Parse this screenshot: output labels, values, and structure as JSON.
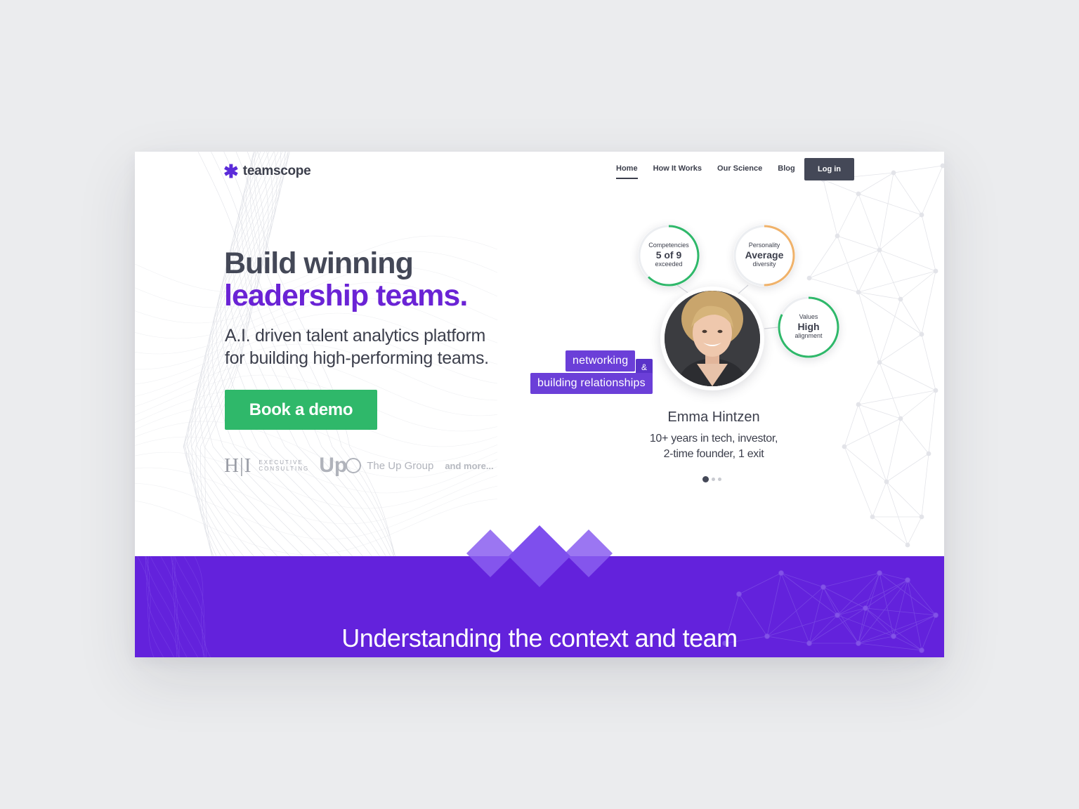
{
  "header": {
    "logo_mark": "✱",
    "logo_text": "teamscope",
    "nav": [
      {
        "label": "Home",
        "active": true
      },
      {
        "label": "How It Works",
        "active": false
      },
      {
        "label": "Our Science",
        "active": false
      },
      {
        "label": "Blog",
        "active": false
      }
    ],
    "login_label": "Log in"
  },
  "hero": {
    "headline_line1": "Build winning",
    "headline_line2": "leadership teams.",
    "subhead_line1": "A.I. driven talent analytics platform",
    "subhead_line2": "for building high-performing teams.",
    "cta_label": "Book a demo"
  },
  "clients": {
    "hi_logo": "H|I",
    "hi_sub_line1": "EXECUTIVE",
    "hi_sub_line2": "CONSULTING",
    "up_logo": "Up",
    "up_name": "The Up Group",
    "more": "and more..."
  },
  "profile": {
    "metrics": [
      {
        "label": "Competencies",
        "value": "5 of 9",
        "note": "exceeded",
        "progress": 0.62,
        "color": "#2fb86a"
      },
      {
        "label": "Personality",
        "value": "Average",
        "note": "diversity",
        "progress": 0.5,
        "color": "#f0b26a"
      },
      {
        "label": "Values",
        "value": "High",
        "note": "alignment",
        "progress": 0.82,
        "color": "#2fb86a"
      }
    ],
    "tags": [
      "networking",
      "building relationships"
    ],
    "amp": "&",
    "name": "Emma Hintzen",
    "desc_line1": "10+ years in tech, investor,",
    "desc_line2": "2-time founder, 1 exit",
    "carousel_active": 1,
    "carousel_count": 3
  },
  "band": {
    "title": "Understanding the context and team"
  },
  "colors": {
    "brand_purple": "#6322dc",
    "cta_green": "#2fb86a",
    "dark": "#444857"
  }
}
